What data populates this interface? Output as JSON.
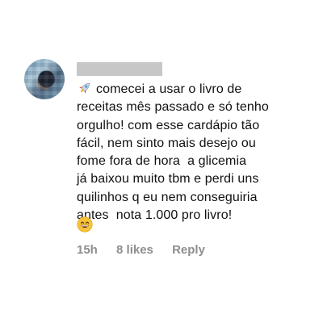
{
  "comment": {
    "text": "comecei a usar o livro de\nreceitas mês passado e só tenho\norgulho! com esse cardápio tão\nfácil, nem sinto mais desejo ou\nfome fora de hora  a glicemia\njá baixou muito tbm e perdi uns\nquilinhos q eu nem conseguiria\nantes  nota 1.000 pro livro!",
    "leading_icon": "rocket-icon",
    "trailing_icon": "grinning-face-icon",
    "timestamp": "15h",
    "likes": "8 likes",
    "reply_label": "Reply"
  },
  "colors": {
    "meta_text": "#8e8e8e",
    "name_redaction": "#c7c7c7"
  }
}
